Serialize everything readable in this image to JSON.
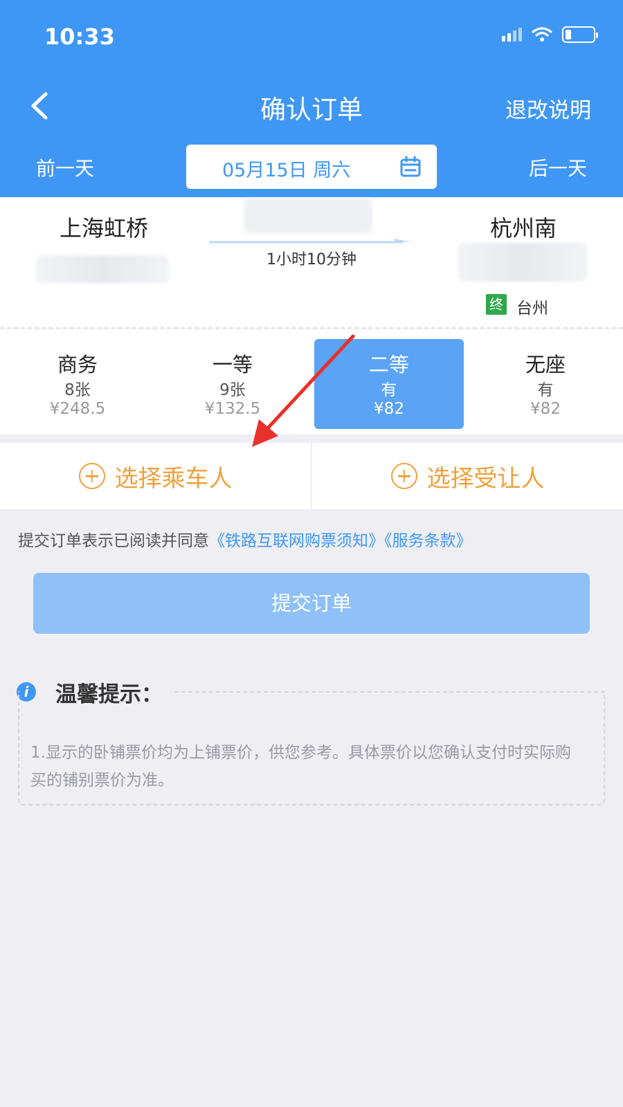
{
  "status_bar": {
    "time": "10:33"
  },
  "nav": {
    "title": "确认订单",
    "refund_link": "退改说明"
  },
  "date_bar": {
    "prev_day": "前一天",
    "date": "05月15日 周六",
    "next_day": "后一天"
  },
  "train": {
    "from_station": "上海虹桥",
    "to_station": "杭州南",
    "duration": "1小时10分钟",
    "end_badge": "终",
    "end_station": "台州"
  },
  "seats": [
    {
      "name": "商务",
      "availability": "8张",
      "price": "¥248.5",
      "selected": false
    },
    {
      "name": "一等",
      "availability": "9张",
      "price": "¥132.5",
      "selected": false
    },
    {
      "name": "二等",
      "availability": "有",
      "price": "¥82",
      "selected": true
    },
    {
      "name": "无座",
      "availability": "有",
      "price": "¥82",
      "selected": false
    }
  ],
  "actions": {
    "select_passenger": "选择乘车人",
    "select_beneficiary": "选择受让人"
  },
  "agreement": {
    "prefix": "提交订单表示已阅读并同意",
    "link1": "《铁路互联网购票须知》",
    "link2": "《服务条款》"
  },
  "submit": {
    "label": "提交订单"
  },
  "tips": {
    "title": "温馨提示：",
    "text": "1.显示的卧铺票价均为上铺票价，供您参考。具体票价以您确认支付时实际购买的铺别票价为准。"
  },
  "colors": {
    "primary": "#3f97f5",
    "accent_orange": "#f0a13c",
    "selected_seat": "#5aa3f5",
    "submit_disabled": "#8fc0f7",
    "annotation_arrow": "#e8312a"
  }
}
